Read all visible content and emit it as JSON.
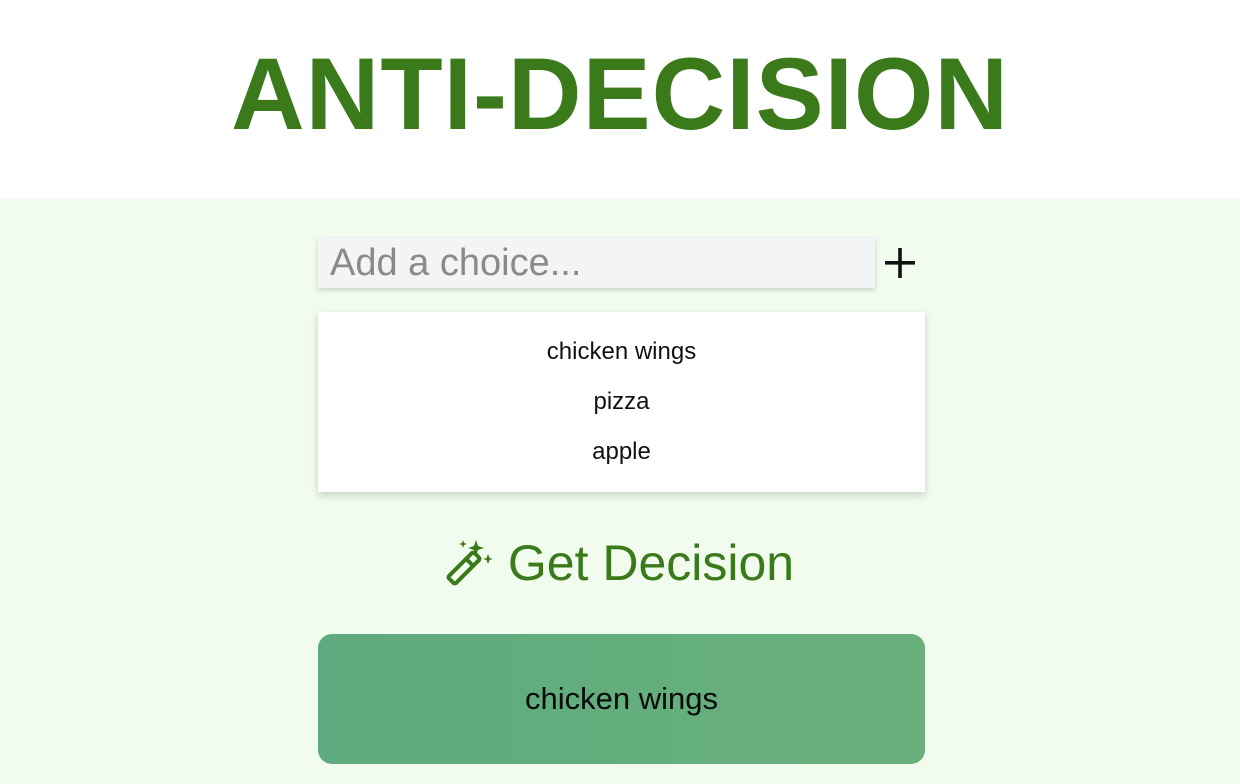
{
  "header": {
    "title": "ANTI-DECISION"
  },
  "input": {
    "placeholder": "Add a choice...",
    "value": ""
  },
  "add_button": {
    "icon": "plus-icon"
  },
  "choices": [
    "chicken wings",
    "pizza",
    "apple"
  ],
  "decision_button": {
    "label": "Get Decision",
    "icon": "magic-wand-icon"
  },
  "result": {
    "text": "chicken wings"
  },
  "colors": {
    "accent": "#3a7a1a",
    "background": "#f1fcef",
    "result_bg": "#62ad7e"
  }
}
